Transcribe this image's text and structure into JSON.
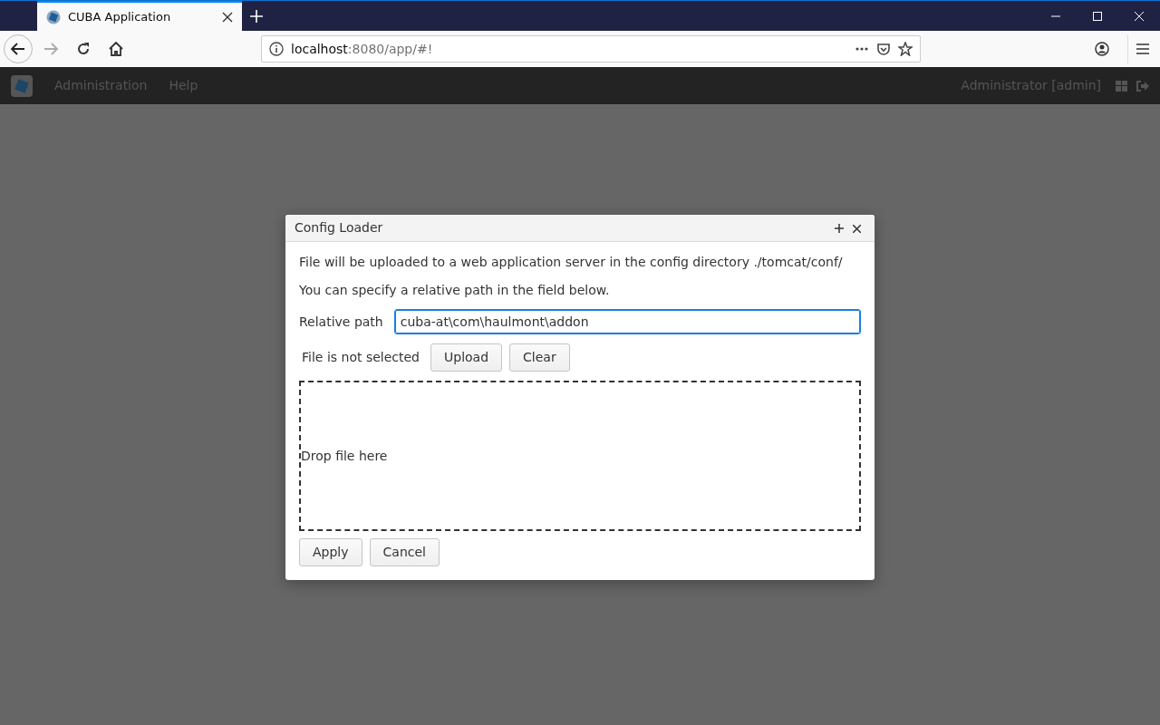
{
  "browser": {
    "tabs": [
      {
        "title": "CUBA Application",
        "selected": true
      }
    ],
    "address": {
      "host": "localhost",
      "rest": ":8080/app/#!"
    }
  },
  "app_menu": {
    "items": [
      {
        "label": "Administration"
      },
      {
        "label": "Help"
      }
    ],
    "user": "Administrator [admin]"
  },
  "dialog": {
    "title": "Config Loader",
    "messages": [
      "File will be uploaded to a web application server in the config directory ./tomcat/conf/",
      "You can specify a relative path in the field below."
    ],
    "path_field": {
      "label": "Relative path",
      "value": "cuba-at\\com\\haulmont\\addon",
      "focused": true
    },
    "upload": {
      "status": "File is not selected",
      "buttons": [
        "Upload",
        "Clear"
      ]
    },
    "drop_zone": {
      "text": "Drop file here"
    },
    "buttons": [
      "Apply",
      "Cancel"
    ]
  }
}
